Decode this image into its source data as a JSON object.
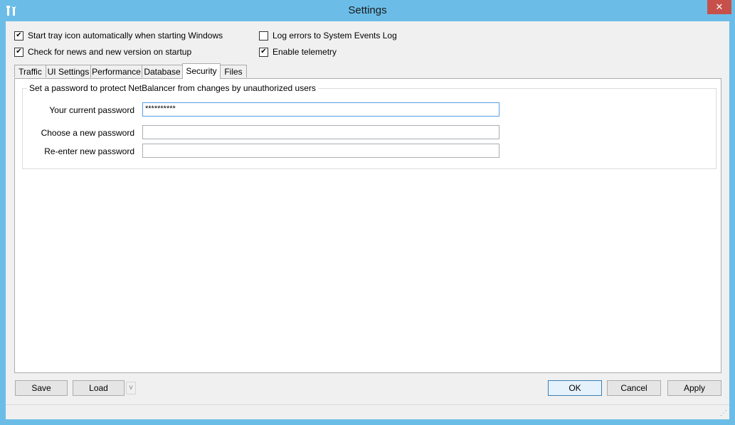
{
  "window": {
    "title": "Settings",
    "close_glyph": "✕",
    "app_icon": "tools-icon",
    "accent_color": "#6bbde8"
  },
  "options": {
    "start_tray": {
      "label": "Start tray icon automatically when starting Windows",
      "checked": true
    },
    "check_news": {
      "label": "Check for news and new version on startup",
      "checked": true
    },
    "log_errors": {
      "label": "Log errors to System Events Log",
      "checked": false
    },
    "telemetry": {
      "label": "Enable telemetry",
      "checked": true
    }
  },
  "tabs": [
    {
      "label": "Traffic"
    },
    {
      "label": "UI Settings"
    },
    {
      "label": "Performance"
    },
    {
      "label": "Database"
    },
    {
      "label": "Security",
      "active": true
    },
    {
      "label": "Files"
    }
  ],
  "security": {
    "group_title": "Set a password to protect NetBalancer from changes by unauthorized users",
    "current_password_label": "Your current password",
    "current_password_value": "**********",
    "new_password_label": "Choose a new password",
    "new_password_value": "",
    "reenter_password_label": "Re-enter new password",
    "reenter_password_value": ""
  },
  "buttons": {
    "save": "Save",
    "load": "Load",
    "load_dropdown": "v",
    "ok": "OK",
    "cancel": "Cancel",
    "apply": "Apply"
  },
  "check_glyph": "✔"
}
